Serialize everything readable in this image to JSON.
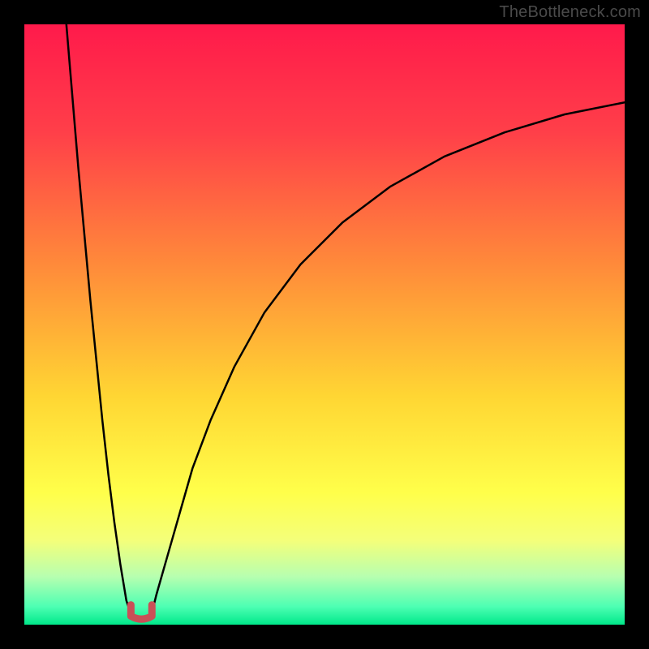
{
  "watermark": "TheBottleneck.com",
  "chart_data": {
    "type": "line",
    "title": "",
    "xlabel": "",
    "ylabel": "",
    "xlim": [
      0,
      100
    ],
    "ylim": [
      0,
      100
    ],
    "grid": false,
    "legend": false,
    "background_gradient": {
      "stops": [
        {
          "pct": 0,
          "color": "#ff1a4b"
        },
        {
          "pct": 18,
          "color": "#ff3f49"
        },
        {
          "pct": 40,
          "color": "#ff8a3a"
        },
        {
          "pct": 62,
          "color": "#ffd633"
        },
        {
          "pct": 78,
          "color": "#ffff4a"
        },
        {
          "pct": 86,
          "color": "#f4ff7a"
        },
        {
          "pct": 92,
          "color": "#b7ffb0"
        },
        {
          "pct": 97,
          "color": "#4dffb3"
        },
        {
          "pct": 100,
          "color": "#00e88a"
        }
      ]
    },
    "series": [
      {
        "name": "left-branch",
        "x": [
          7,
          8,
          9,
          10,
          11,
          12,
          13,
          14,
          15,
          16,
          17,
          18
        ],
        "y": [
          100,
          88,
          76,
          65,
          54,
          44,
          34,
          25,
          17,
          10,
          4,
          1
        ],
        "stroke": "#000000",
        "stroke_width": 2.5
      },
      {
        "name": "right-branch",
        "x": [
          21,
          22,
          24,
          26,
          28,
          31,
          35,
          40,
          46,
          53,
          61,
          70,
          80,
          90,
          100
        ],
        "y": [
          1,
          5,
          12,
          19,
          26,
          34,
          43,
          52,
          60,
          67,
          73,
          78,
          82,
          85,
          87
        ],
        "stroke": "#000000",
        "stroke_width": 2.5
      },
      {
        "name": "valley-marker",
        "shape": "u",
        "x_center": 19.5,
        "y_base": 0.8,
        "width": 3.5,
        "height": 2.5,
        "stroke": "#c94f57",
        "stroke_width": 9
      }
    ]
  }
}
